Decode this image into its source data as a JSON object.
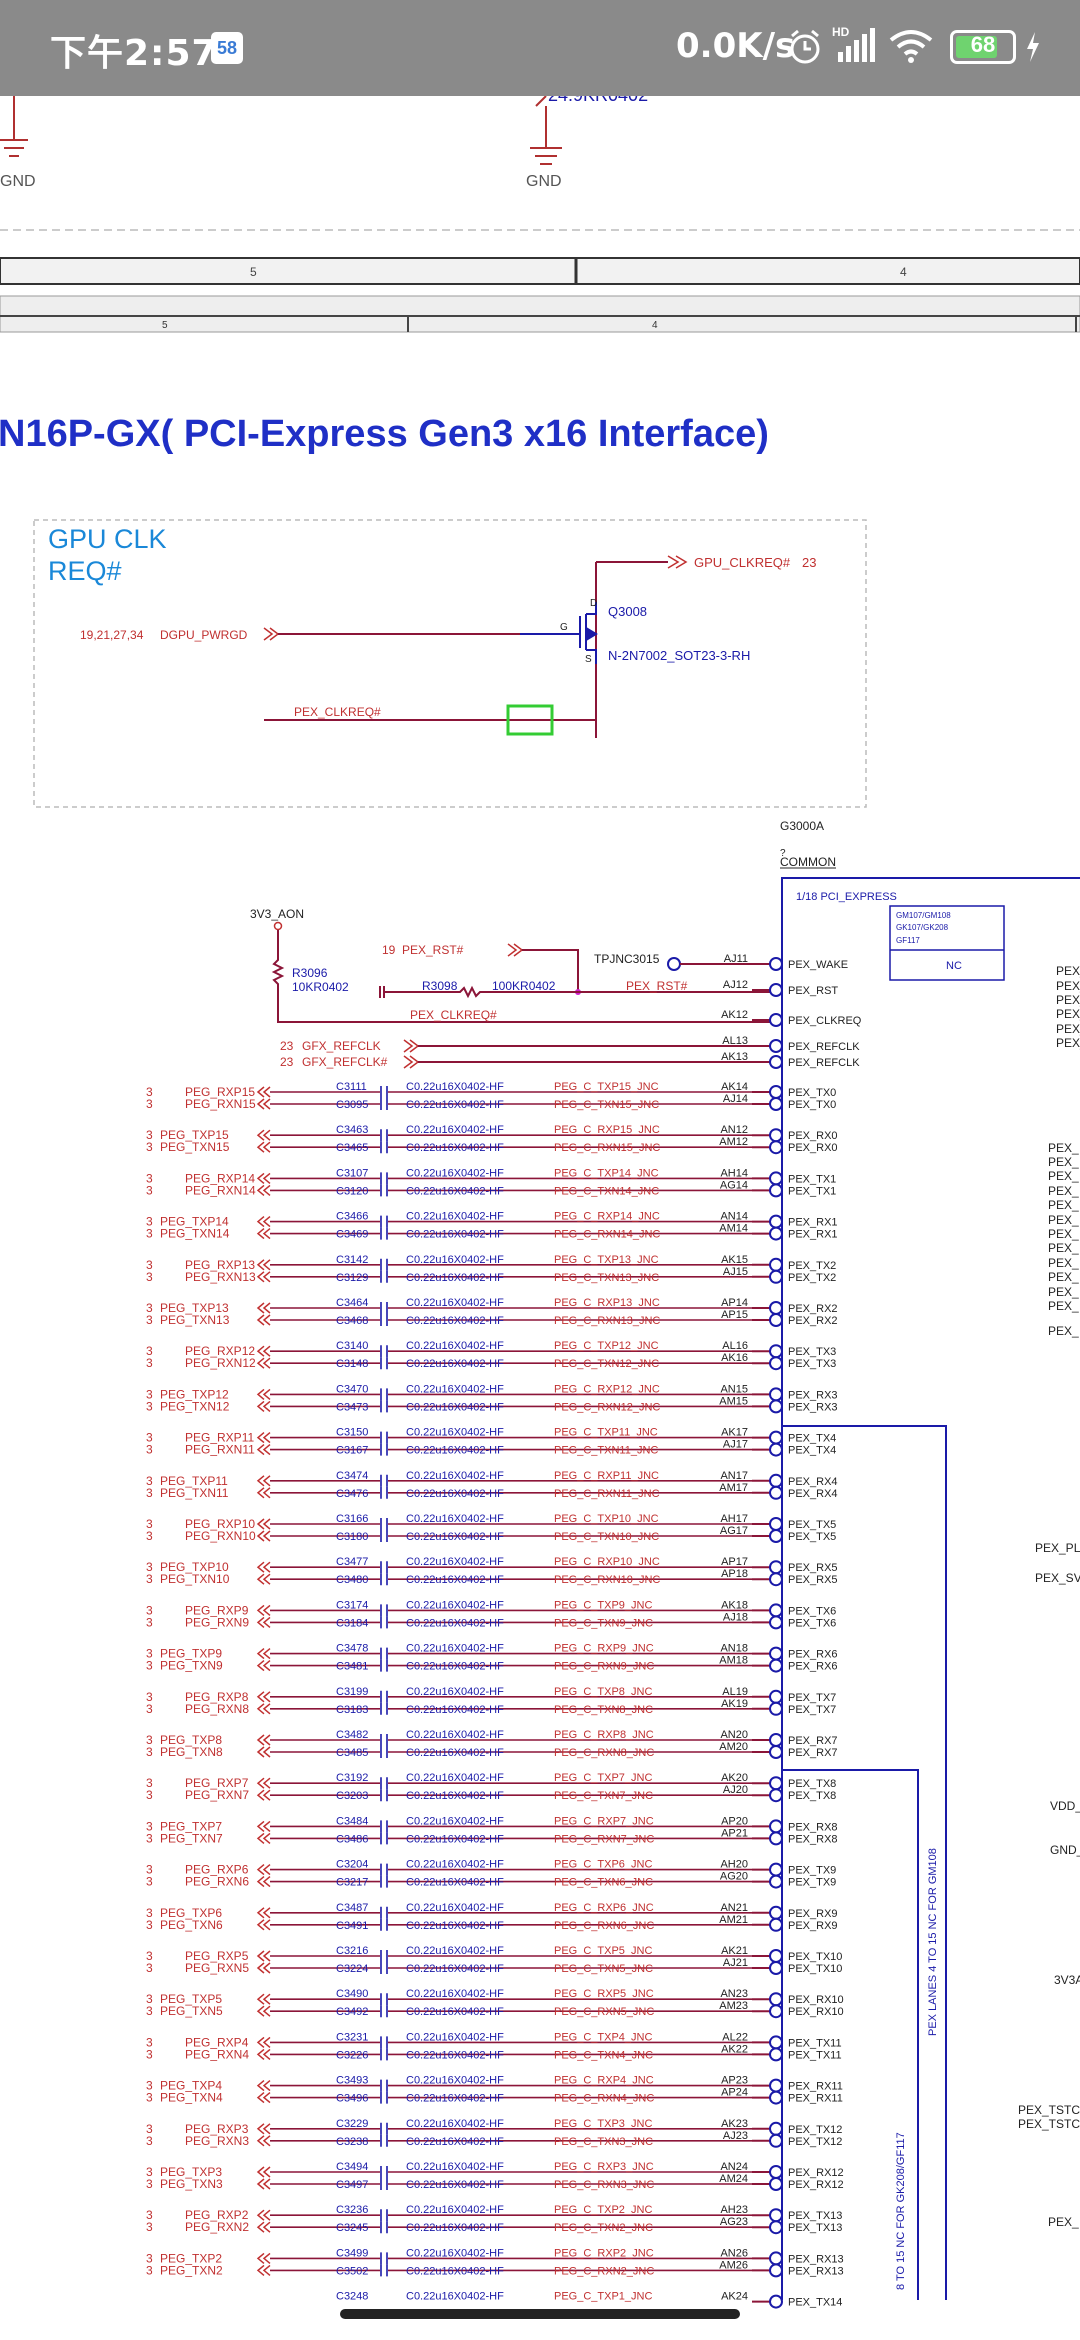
{
  "status_bar": {
    "time": "下午2:57",
    "app_badge": "58",
    "net_speed": "0.0K/s",
    "signal_label": "HD",
    "battery": "68"
  },
  "schematic": {
    "partial_labels": [
      "24.9KR0402",
      "GND",
      "GND"
    ],
    "border_zones": [
      "5",
      "4",
      "5",
      "4"
    ],
    "title": "N16P-GX( PCI-Express Gen3 x16 Interface)",
    "box_title": [
      "GPU CLK",
      "REQ#"
    ],
    "transistor": {
      "ref": "Q3008",
      "part": "N-2N7002_SOT23-3-RH",
      "pins": [
        "D",
        "G",
        "S"
      ]
    },
    "gpu_clkreq": {
      "net": "GPU_CLKREQ#",
      "page": "23"
    },
    "dgpu_pwrgd": {
      "pages": "19,21,27,34",
      "net": "DGPU_PWRGD"
    },
    "pex_clkreq_net": "PEX_CLKREQ#",
    "ic": {
      "ref": "G3000A",
      "sub": "?",
      "common": "COMMON",
      "section": "1/18 PCI_EXPRESS",
      "variants": [
        "GM107/GM108",
        "GK107/GK208",
        "GF117"
      ],
      "nc": "NC"
    },
    "power_3v3": "3V3_AON",
    "r3096": {
      "ref": "R3096",
      "val": "10KR0402"
    },
    "r3098": {
      "ref": "R3098",
      "val": "100KR0402"
    },
    "pex_rst_in": {
      "page": "19",
      "net": "PEX_RST#"
    },
    "tp": "TPJNC3015",
    "pex_rst_out": "PEX_RST#",
    "pex_clkreq_wire": "PEX_CLKREQ#",
    "refclk": [
      {
        "page": "23",
        "net": "GFX_REFCLK",
        "ball": "AL13",
        "pin": "PEX_REFCLK"
      },
      {
        "page": "23",
        "net": "GFX_REFCLK#",
        "ball": "AK13",
        "pin": "PEX_REFCLK"
      }
    ],
    "ctrl_pins": [
      {
        "ball": "AJ11",
        "pin": "PEX_WAKE"
      },
      {
        "ball": "AJ12",
        "pin": "PEX_RST"
      },
      {
        "ball": "AK12",
        "pin": "PEX_CLKREQ"
      }
    ],
    "cap_value": "C0.22u16X0402-HF",
    "lane_pairs": [
      {
        "pg": "3",
        "n1": "PEG_RXP15",
        "n2": "PEG_RXN15",
        "c1": "C3111",
        "c2": "C3095",
        "s1": "PEG_C_TXP15_JNC",
        "s2": "PEG_C_TXN15_JNC",
        "b1": "AK14",
        "b2": "AJ14",
        "p1": "PEX_TX0",
        "p2": "PEX_TX0"
      },
      {
        "pg": "3",
        "n1": "PEG_TXP15",
        "n2": "PEG_TXN15",
        "c1": "C3463",
        "c2": "C3465",
        "s1": "PEG_C_RXP15_JNC",
        "s2": "PEG_C_RXN15_JNC",
        "b1": "AN12",
        "b2": "AM12",
        "p1": "PEX_RX0",
        "p2": "PEX_RX0"
      },
      {
        "pg": "3",
        "n1": "PEG_RXP14",
        "n2": "PEG_RXN14",
        "c1": "C3107",
        "c2": "C3120",
        "s1": "PEG_C_TXP14_JNC",
        "s2": "PEG_C_TXN14_JNC",
        "b1": "AH14",
        "b2": "AG14",
        "p1": "PEX_TX1",
        "p2": "PEX_TX1"
      },
      {
        "pg": "3",
        "n1": "PEG_TXP14",
        "n2": "PEG_TXN14",
        "c1": "C3466",
        "c2": "C3469",
        "s1": "PEG_C_RXP14_JNC",
        "s2": "PEG_C_RXN14_JNC",
        "b1": "AN14",
        "b2": "AM14",
        "p1": "PEX_RX1",
        "p2": "PEX_RX1"
      },
      {
        "pg": "3",
        "n1": "PEG_RXP13",
        "n2": "PEG_RXN13",
        "c1": "C3142",
        "c2": "C3129",
        "s1": "PEG_C_TXP13_JNC",
        "s2": "PEG_C_TXN13_JNC",
        "b1": "AK15",
        "b2": "AJ15",
        "p1": "PEX_TX2",
        "p2": "PEX_TX2"
      },
      {
        "pg": "3",
        "n1": "PEG_TXP13",
        "n2": "PEG_TXN13",
        "c1": "C3464",
        "c2": "C3468",
        "s1": "PEG_C_RXP13_JNC",
        "s2": "PEG_C_RXN13_JNC",
        "b1": "AP14",
        "b2": "AP15",
        "p1": "PEX_RX2",
        "p2": "PEX_RX2"
      },
      {
        "pg": "3",
        "n1": "PEG_RXP12",
        "n2": "PEG_RXN12",
        "c1": "C3140",
        "c2": "C3148",
        "s1": "PEG_C_TXP12_JNC",
        "s2": "PEG_C_TXN12_JNC",
        "b1": "AL16",
        "b2": "AK16",
        "p1": "PEX_TX3",
        "p2": "PEX_TX3"
      },
      {
        "pg": "3",
        "n1": "PEG_TXP12",
        "n2": "PEG_TXN12",
        "c1": "C3470",
        "c2": "C3473",
        "s1": "PEG_C_RXP12_JNC",
        "s2": "PEG_C_RXN12_JNC",
        "b1": "AN15",
        "b2": "AM15",
        "p1": "PEX_RX3",
        "p2": "PEX_RX3"
      },
      {
        "pg": "3",
        "n1": "PEG_RXP11",
        "n2": "PEG_RXN11",
        "c1": "C3150",
        "c2": "C3167",
        "s1": "PEG_C_TXP11_JNC",
        "s2": "PEG_C_TXN11_JNC",
        "b1": "AK17",
        "b2": "AJ17",
        "p1": "PEX_TX4",
        "p2": "PEX_TX4"
      },
      {
        "pg": "3",
        "n1": "PEG_TXP11",
        "n2": "PEG_TXN11",
        "c1": "C3474",
        "c2": "C3476",
        "s1": "PEG_C_RXP11_JNC",
        "s2": "PEG_C_RXN11_JNC",
        "b1": "AN17",
        "b2": "AM17",
        "p1": "PEX_RX4",
        "p2": "PEX_RX4"
      },
      {
        "pg": "3",
        "n1": "PEG_RXP10",
        "n2": "PEG_RXN10",
        "c1": "C3166",
        "c2": "C3180",
        "s1": "PEG_C_TXP10_JNC",
        "s2": "PEG_C_TXN10_JNC",
        "b1": "AH17",
        "b2": "AG17",
        "p1": "PEX_TX5",
        "p2": "PEX_TX5"
      },
      {
        "pg": "3",
        "n1": "PEG_TXP10",
        "n2": "PEG_TXN10",
        "c1": "C3477",
        "c2": "C3480",
        "s1": "PEG_C_RXP10_JNC",
        "s2": "PEG_C_RXN10_JNC",
        "b1": "AP17",
        "b2": "AP18",
        "p1": "PEX_RX5",
        "p2": "PEX_RX5"
      },
      {
        "pg": "3",
        "n1": "PEG_RXP9",
        "n2": "PEG_RXN9",
        "c1": "C3174",
        "c2": "C3184",
        "s1": "PEG_C_TXP9_JNC",
        "s2": "PEG_C_TXN9_JNC",
        "b1": "AK18",
        "b2": "AJ18",
        "p1": "PEX_TX6",
        "p2": "PEX_TX6"
      },
      {
        "pg": "3",
        "n1": "PEG_TXP9",
        "n2": "PEG_TXN9",
        "c1": "C3478",
        "c2": "C3481",
        "s1": "PEG_C_RXP9_JNC",
        "s2": "PEG_C_RXN9_JNC",
        "b1": "AN18",
        "b2": "AM18",
        "p1": "PEX_RX6",
        "p2": "PEX_RX6"
      },
      {
        "pg": "3",
        "n1": "PEG_RXP8",
        "n2": "PEG_RXN8",
        "c1": "C3199",
        "c2": "C3183",
        "s1": "PEG_C_TXP8_JNC",
        "s2": "PEG_C_TXN8_JNC",
        "b1": "AL19",
        "b2": "AK19",
        "p1": "PEX_TX7",
        "p2": "PEX_TX7"
      },
      {
        "pg": "3",
        "n1": "PEG_TXP8",
        "n2": "PEG_TXN8",
        "c1": "C3482",
        "c2": "C3485",
        "s1": "PEG_C_RXP8_JNC",
        "s2": "PEG_C_RXN8_JNC",
        "b1": "AN20",
        "b2": "AM20",
        "p1": "PEX_RX7",
        "p2": "PEX_RX7"
      },
      {
        "pg": "3",
        "n1": "PEG_RXP7",
        "n2": "PEG_RXN7",
        "c1": "C3192",
        "c2": "C3203",
        "s1": "PEG_C_TXP7_JNC",
        "s2": "PEG_C_TXN7_JNC",
        "b1": "AK20",
        "b2": "AJ20",
        "p1": "PEX_TX8",
        "p2": "PEX_TX8"
      },
      {
        "pg": "3",
        "n1": "PEG_TXP7",
        "n2": "PEG_TXN7",
        "c1": "C3484",
        "c2": "C3486",
        "s1": "PEG_C_RXP7_JNC",
        "s2": "PEG_C_RXN7_JNC",
        "b1": "AP20",
        "b2": "AP21",
        "p1": "PEX_RX8",
        "p2": "PEX_RX8"
      },
      {
        "pg": "3",
        "n1": "PEG_RXP6",
        "n2": "PEG_RXN6",
        "c1": "C3204",
        "c2": "C3217",
        "s1": "PEG_C_TXP6_JNC",
        "s2": "PEG_C_TXN6_JNC",
        "b1": "AH20",
        "b2": "AG20",
        "p1": "PEX_TX9",
        "p2": "PEX_TX9"
      },
      {
        "pg": "3",
        "n1": "PEG_TXP6",
        "n2": "PEG_TXN6",
        "c1": "C3487",
        "c2": "C3491",
        "s1": "PEG_C_RXP6_JNC",
        "s2": "PEG_C_RXN6_JNC",
        "b1": "AN21",
        "b2": "AM21",
        "p1": "PEX_RX9",
        "p2": "PEX_RX9"
      },
      {
        "pg": "3",
        "n1": "PEG_RXP5",
        "n2": "PEG_RXN5",
        "c1": "C3216",
        "c2": "C3224",
        "s1": "PEG_C_TXP5_JNC",
        "s2": "PEG_C_TXN5_JNC",
        "b1": "AK21",
        "b2": "AJ21",
        "p1": "PEX_TX10",
        "p2": "PEX_TX10"
      },
      {
        "pg": "3",
        "n1": "PEG_TXP5",
        "n2": "PEG_TXN5",
        "c1": "C3490",
        "c2": "C3492",
        "s1": "PEG_C_RXP5_JNC",
        "s2": "PEG_C_RXN5_JNC",
        "b1": "AN23",
        "b2": "AM23",
        "p1": "PEX_RX10",
        "p2": "PEX_RX10"
      },
      {
        "pg": "3",
        "n1": "PEG_RXP4",
        "n2": "PEG_RXN4",
        "c1": "C3231",
        "c2": "C3226",
        "s1": "PEG_C_TXP4_JNC",
        "s2": "PEG_C_TXN4_JNC",
        "b1": "AL22",
        "b2": "AK22",
        "p1": "PEX_TX11",
        "p2": "PEX_TX11"
      },
      {
        "pg": "3",
        "n1": "PEG_TXP4",
        "n2": "PEG_TXN4",
        "c1": "C3493",
        "c2": "C3496",
        "s1": "PEG_C_RXP4_JNC",
        "s2": "PEG_C_RXN4_JNC",
        "b1": "AP23",
        "b2": "AP24",
        "p1": "PEX_RX11",
        "p2": "PEX_RX11"
      },
      {
        "pg": "3",
        "n1": "PEG_RXP3",
        "n2": "PEG_RXN3",
        "c1": "C3229",
        "c2": "C3238",
        "s1": "PEG_C_TXP3_JNC",
        "s2": "PEG_C_TXN3_JNC",
        "b1": "AK23",
        "b2": "AJ23",
        "p1": "PEX_TX12",
        "p2": "PEX_TX12"
      },
      {
        "pg": "3",
        "n1": "PEG_TXP3",
        "n2": "PEG_TXN3",
        "c1": "C3494",
        "c2": "C3497",
        "s1": "PEG_C_RXP3_JNC",
        "s2": "PEG_C_RXN3_JNC",
        "b1": "AN24",
        "b2": "AM24",
        "p1": "PEX_RX12",
        "p2": "PEX_RX12"
      },
      {
        "pg": "3",
        "n1": "PEG_RXP2",
        "n2": "PEG_RXN2",
        "c1": "C3236",
        "c2": "C3245",
        "s1": "PEG_C_TXP2_JNC",
        "s2": "PEG_C_TXN2_JNC",
        "b1": "AH23",
        "b2": "AG23",
        "p1": "PEX_TX13",
        "p2": "PEX_TX13"
      },
      {
        "pg": "3",
        "n1": "PEG_TXP2",
        "n2": "PEG_TXN2",
        "c1": "C3499",
        "c2": "C3502",
        "s1": "PEG_C_RXP2_JNC",
        "s2": "PEG_C_RXN2_JNC",
        "b1": "AN26",
        "b2": "AM26",
        "p1": "PEX_RX13",
        "p2": "PEX_RX13"
      },
      {
        "pg": "",
        "n1": "",
        "n2": "",
        "c1": "C3248",
        "c2": "",
        "s1": "PEG_C_TXP1_JNC",
        "s2": "",
        "b1": "AK24",
        "b2": "",
        "p1": "PEX_TX14",
        "p2": ""
      }
    ],
    "vertical_notes": [
      "PEX LANES 4 TO 15 NC FOR GM108",
      "8 TO 15 NC FOR GK208/GF117"
    ],
    "right_edge_labels": [
      "PEX_",
      "PEX_",
      "PEX_",
      "PEX_",
      "PEX_",
      "PEX_",
      "PEX_",
      "PEX_",
      "PEX_",
      "PEX_",
      "PEX_",
      "PEX_",
      "PEX_",
      "PEX_",
      "PEX_",
      "PEX_",
      "PEX_",
      "PEX_",
      "PEX_",
      "PEX_PL",
      "PEX_SV",
      "VDD_",
      "GND_",
      "3V3A",
      "PEX_TSTC",
      "PEX_TSTC",
      "PEX_"
    ]
  }
}
